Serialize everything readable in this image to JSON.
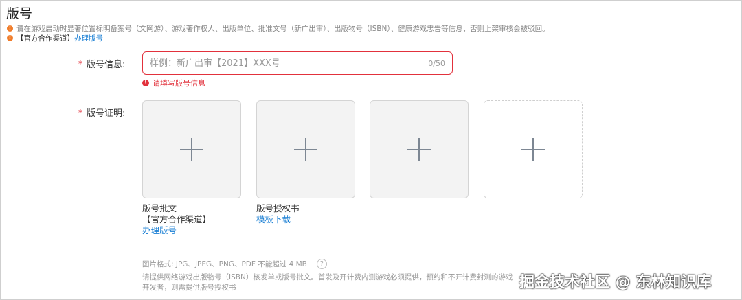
{
  "section": {
    "title": "版号"
  },
  "notices": {
    "line1": "请在游戏启动时显著位置标明备案号（文网游）、游戏著作权人、出版单位、批准文号（新广出审）、出版物号（ISBN）、健康游戏忠告等信息，否则上架审核会被驳回。",
    "line2_prefix": "【官方合作渠道】",
    "line2_link": "办理版号"
  },
  "form": {
    "info_label": "版号信息:",
    "info_required": "*",
    "info_placeholder": "样例：新广出审【2021】XXX号",
    "info_value": "",
    "info_counter": "0/50",
    "info_error": "请填写版号信息",
    "proof_label": "版号证明:",
    "proof_required": "*"
  },
  "uploads": [
    {
      "caption_line1": "版号批文",
      "caption_line2": "【官方合作渠道】",
      "caption_link": "办理版号"
    },
    {
      "caption_line1": "版号授权书",
      "caption_link": "模板下载"
    },
    {},
    {}
  ],
  "hints": {
    "format": "图片格式: JPG、JPEG、PNG、PDF 不能超过 4 MB",
    "help_glyph": "?",
    "desc_line1": "请提供网络游戏出版物号（ISBN）核发单或版号批文。首发及开计费内测游戏必须提供，预约和不开计费封测的游戏",
    "desc_line2": "开发者，则需提供版号授权书"
  },
  "watermark": "掘金技术社区 @ 东林知识库",
  "colors": {
    "accent_link": "#1a7fd4",
    "error": "#e2313c",
    "warning": "#f07c2a"
  },
  "icons": {
    "notice": "warning-icon",
    "error": "error-icon",
    "upload": "plus-icon",
    "help": "question-icon"
  }
}
